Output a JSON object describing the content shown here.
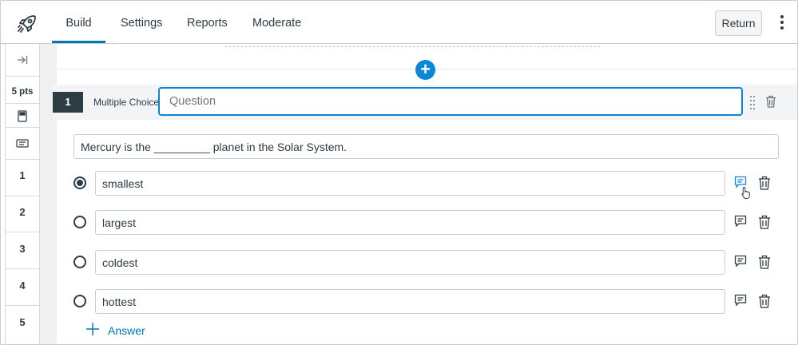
{
  "nav": {
    "tabs": [
      {
        "label": "Build",
        "active": true
      },
      {
        "label": "Settings",
        "active": false
      },
      {
        "label": "Reports",
        "active": false
      },
      {
        "label": "Moderate",
        "active": false
      }
    ],
    "return_label": "Return"
  },
  "rail": {
    "points": "5 pts",
    "questions": [
      "1",
      "2",
      "3",
      "4",
      "5"
    ]
  },
  "question": {
    "number": "1",
    "type": "Multiple Choice",
    "title_placeholder": "Question",
    "stem": "Mercury is the _________ planet in the Solar System.",
    "answers": [
      {
        "text": "smallest",
        "selected": true
      },
      {
        "text": "largest",
        "selected": false
      },
      {
        "text": "coldest",
        "selected": false
      },
      {
        "text": "hottest",
        "selected": false
      }
    ],
    "add_answer_label": "Answer"
  },
  "colors": {
    "accent": "#0374b5",
    "add_button": "#0b87d6",
    "text": "#2d3b45"
  },
  "icons": {
    "logo": "rocket-icon",
    "collapse": "collapse-arrow-icon",
    "calculator": "calculator-icon",
    "preview": "preview-icon",
    "feedback": "comment-icon",
    "delete": "trash-icon",
    "add": "plus-icon"
  }
}
